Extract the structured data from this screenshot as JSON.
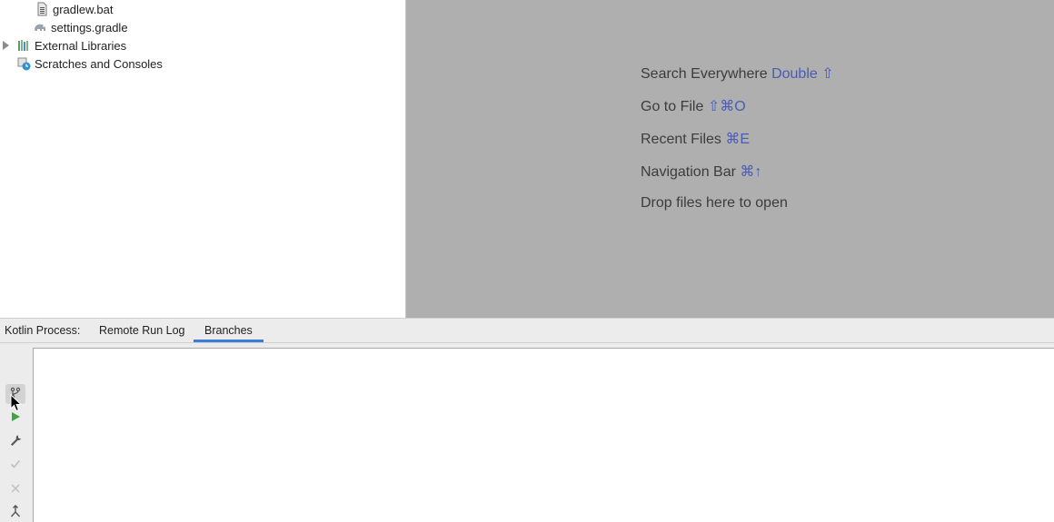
{
  "project_tree": {
    "items": [
      {
        "label": "gradlew.bat",
        "icon": "bat-file-icon"
      },
      {
        "label": "settings.gradle",
        "icon": "gradle-elephant-icon"
      },
      {
        "label": "External Libraries",
        "icon": "library-icon"
      },
      {
        "label": "Scratches and Consoles",
        "icon": "scratches-icon"
      }
    ]
  },
  "editor_empty": {
    "hints": [
      {
        "text": "Search Everywhere",
        "shortcut": "Double ⇧"
      },
      {
        "text": "Go to File",
        "shortcut": "⇧⌘O"
      },
      {
        "text": "Recent Files",
        "shortcut": "⌘E"
      },
      {
        "text": "Navigation Bar",
        "shortcut": "⌘↑"
      },
      {
        "text": "Drop files here to open",
        "shortcut": ""
      }
    ]
  },
  "tool_window": {
    "prefix": "Kotlin Process:",
    "tabs": [
      {
        "label": "Remote Run Log",
        "selected": false
      },
      {
        "label": "Branches",
        "selected": true
      }
    ],
    "side_toolbar": [
      "branch-icon",
      "run-icon",
      "wrench-icon",
      "check-icon",
      "close-icon",
      "merge-icon"
    ]
  },
  "colors": {
    "accent": "#3a7cd6",
    "shortcut": "#4a5bb5",
    "run_green": "#3fa63f",
    "editor_bg": "#afafaf"
  }
}
